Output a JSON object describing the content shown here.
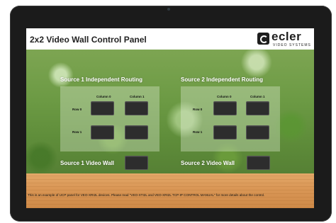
{
  "header": {
    "title": "2x2 Video Wall Control Panel",
    "logo_text": "ecler",
    "logo_sub": "VIDEO SYSTEMS"
  },
  "source1": {
    "title": "Source 1 Independent Routing",
    "col0": "Column 0",
    "col1": "Column 1",
    "row0": "Row 0",
    "row1": "Row 1",
    "wall_label": "Source 1 Video Wall"
  },
  "source2": {
    "title": "Source 2 Independent Routing",
    "col0": "Column 0",
    "col1": "Column 1",
    "row0": "Row 0",
    "row1": "Row 1",
    "wall_label": "Source 2 Video Wall"
  },
  "footer": {
    "note": "This is an example of UCP panel for VEO-XRI2L devices. Please read \"VEO-XTI2L and VEO-XRI2L TCP-IP CONTROL MANUAL\" for more details about the control."
  }
}
